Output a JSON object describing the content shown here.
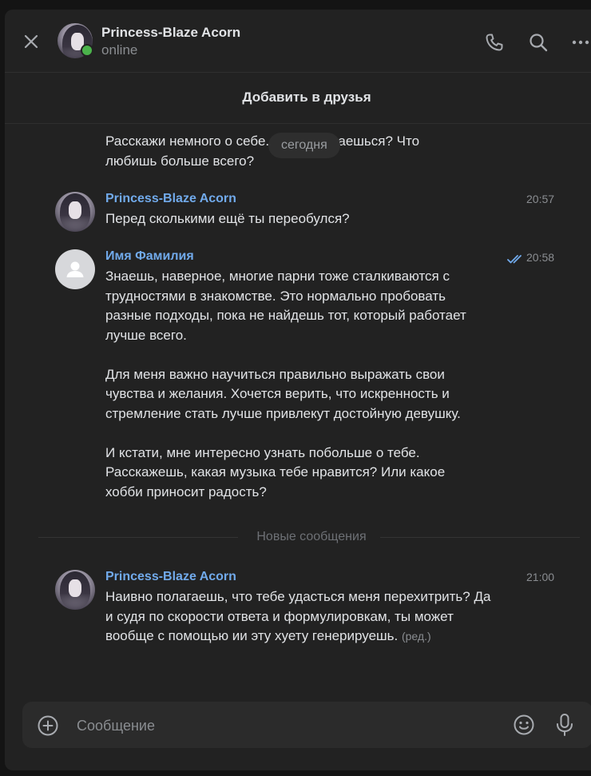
{
  "header": {
    "title": "Princess-Blaze Acorn",
    "status": "online"
  },
  "add_friend": {
    "label": "Добавить в друзья"
  },
  "date_pill": "сегодня",
  "messages": [
    {
      "text": "Расскажи немного о себе. Чем увлекаешься? Что\nлюбишь больше всего?"
    },
    {
      "author": "Princess-Blaze Acorn",
      "time": "20:57",
      "text": "Перед сколькими ещё ты переобулся?"
    },
    {
      "author": "Имя Фамилия",
      "time": "20:58",
      "text": "Знаешь, наверное, многие парни тоже сталкиваются с\nтрудностями в знакомстве. Это нормально пробовать\nразные подходы, пока не найдешь тот, который работает\nлучше всего.\n\nДля меня важно научиться правильно выражать свои\nчувства и желания. Хочется верить, что искренность и\nстремление стать лучше привлекут достойную девушку.\n\nИ кстати, мне интересно узнать побольше о тебе.\nРасскажешь, какая музыка тебе нравится? Или какое\nхобби приносит радость?"
    },
    {
      "author": "Princess-Blaze Acorn",
      "time": "21:00",
      "text": "Наивно полагаешь, что тебе удасться меня перехитрить? Да\nи судя по скорости ответа и формулировкам, ты может\nвообще с помощью ии эту хуету генерируешь.",
      "edited": "(ред.)"
    }
  ],
  "new_messages_label": "Новые сообщения",
  "composer": {
    "placeholder": "Сообщение"
  },
  "colors": {
    "accent": "#71aaeb",
    "online": "#4bb34b",
    "background": "#222222"
  }
}
